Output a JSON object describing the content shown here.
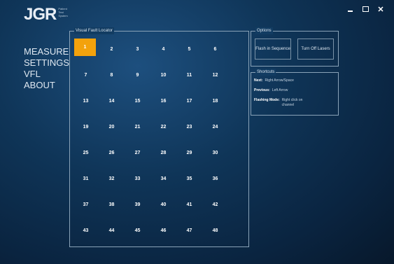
{
  "logo": {
    "mark": "JGR",
    "subtitle": "Patient Test System"
  },
  "window": {
    "minimize": "",
    "maximize": "",
    "close": "✕"
  },
  "sidebar": {
    "items": [
      "MEASURE",
      "SETTINGS",
      "VFL",
      "ABOUT"
    ]
  },
  "vfl": {
    "legend": "Visual Fault Locator",
    "selected": 1,
    "cells": [
      "1",
      "2",
      "3",
      "4",
      "5",
      "6",
      "7",
      "8",
      "9",
      "10",
      "11",
      "12",
      "13",
      "14",
      "15",
      "16",
      "17",
      "18",
      "19",
      "20",
      "21",
      "22",
      "23",
      "24",
      "25",
      "26",
      "27",
      "28",
      "29",
      "30",
      "31",
      "32",
      "33",
      "34",
      "35",
      "36",
      "37",
      "38",
      "39",
      "40",
      "41",
      "42",
      "43",
      "44",
      "45",
      "46",
      "47",
      "48"
    ]
  },
  "options": {
    "legend": "Options",
    "flash_label": "Flash in Sequence",
    "turn_off_label": "Turn Off Lasers"
  },
  "shortcuts": {
    "legend": "Shortcuts",
    "items": [
      {
        "key": "Next:",
        "value": "Right Arrow/Space"
      },
      {
        "key": "Previous:",
        "value": "Left Arrow"
      },
      {
        "key": "Flashing Mode:",
        "value": "Right click on channel"
      }
    ]
  },
  "colors": {
    "accent": "#f3a20c",
    "border": "#8aa3b8",
    "background": "#0f3558"
  }
}
